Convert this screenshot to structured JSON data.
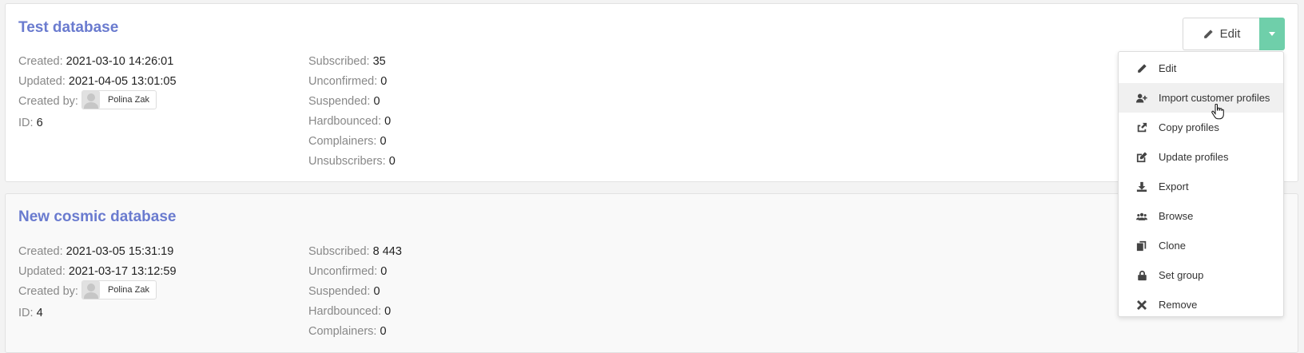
{
  "databases": [
    {
      "title": "Test database",
      "created_label": "Created:",
      "created": "2021-03-10 14:26:01",
      "updated_label": "Updated:",
      "updated": "2021-04-05 13:01:05",
      "created_by_label": "Created by:",
      "created_by": "Polina Zak",
      "id_label": "ID:",
      "id": "6",
      "subscribed_label": "Subscribed:",
      "subscribed": "35",
      "unconfirmed_label": "Unconfirmed:",
      "unconfirmed": "0",
      "suspended_label": "Suspended:",
      "suspended": "0",
      "hardbounced_label": "Hardbounced:",
      "hardbounced": "0",
      "complainers_label": "Complainers:",
      "complainers": "0",
      "unsubscribers_label": "Unsubscribers:",
      "unsubscribers": "0",
      "edit_label": "Edit"
    },
    {
      "title": "New cosmic database",
      "created_label": "Created:",
      "created": "2021-03-05 15:31:19",
      "updated_label": "Updated:",
      "updated": "2021-03-17 13:12:59",
      "created_by_label": "Created by:",
      "created_by": "Polina Zak",
      "id_label": "ID:",
      "id": "4",
      "subscribed_label": "Subscribed:",
      "subscribed": "8 443",
      "unconfirmed_label": "Unconfirmed:",
      "unconfirmed": "0",
      "suspended_label": "Suspended:",
      "suspended": "0",
      "hardbounced_label": "Hardbounced:",
      "hardbounced": "0",
      "complainers_label": "Complainers:",
      "complainers": "0"
    }
  ],
  "dropdown": {
    "items": [
      {
        "label": "Edit",
        "icon": "pencil-icon"
      },
      {
        "label": "Import customer profiles",
        "icon": "user-plus-icon"
      },
      {
        "label": "Copy profiles",
        "icon": "share-icon"
      },
      {
        "label": "Update profiles",
        "icon": "edit-square-icon"
      },
      {
        "label": "Export",
        "icon": "download-icon"
      },
      {
        "label": "Browse",
        "icon": "users-icon"
      },
      {
        "label": "Clone",
        "icon": "copy-icon"
      },
      {
        "label": "Set group",
        "icon": "lock-icon"
      },
      {
        "label": "Remove",
        "icon": "times-icon"
      }
    ],
    "active_index": 1
  },
  "colors": {
    "title": "#6a7bcf",
    "accent": "#6fcfaa"
  }
}
